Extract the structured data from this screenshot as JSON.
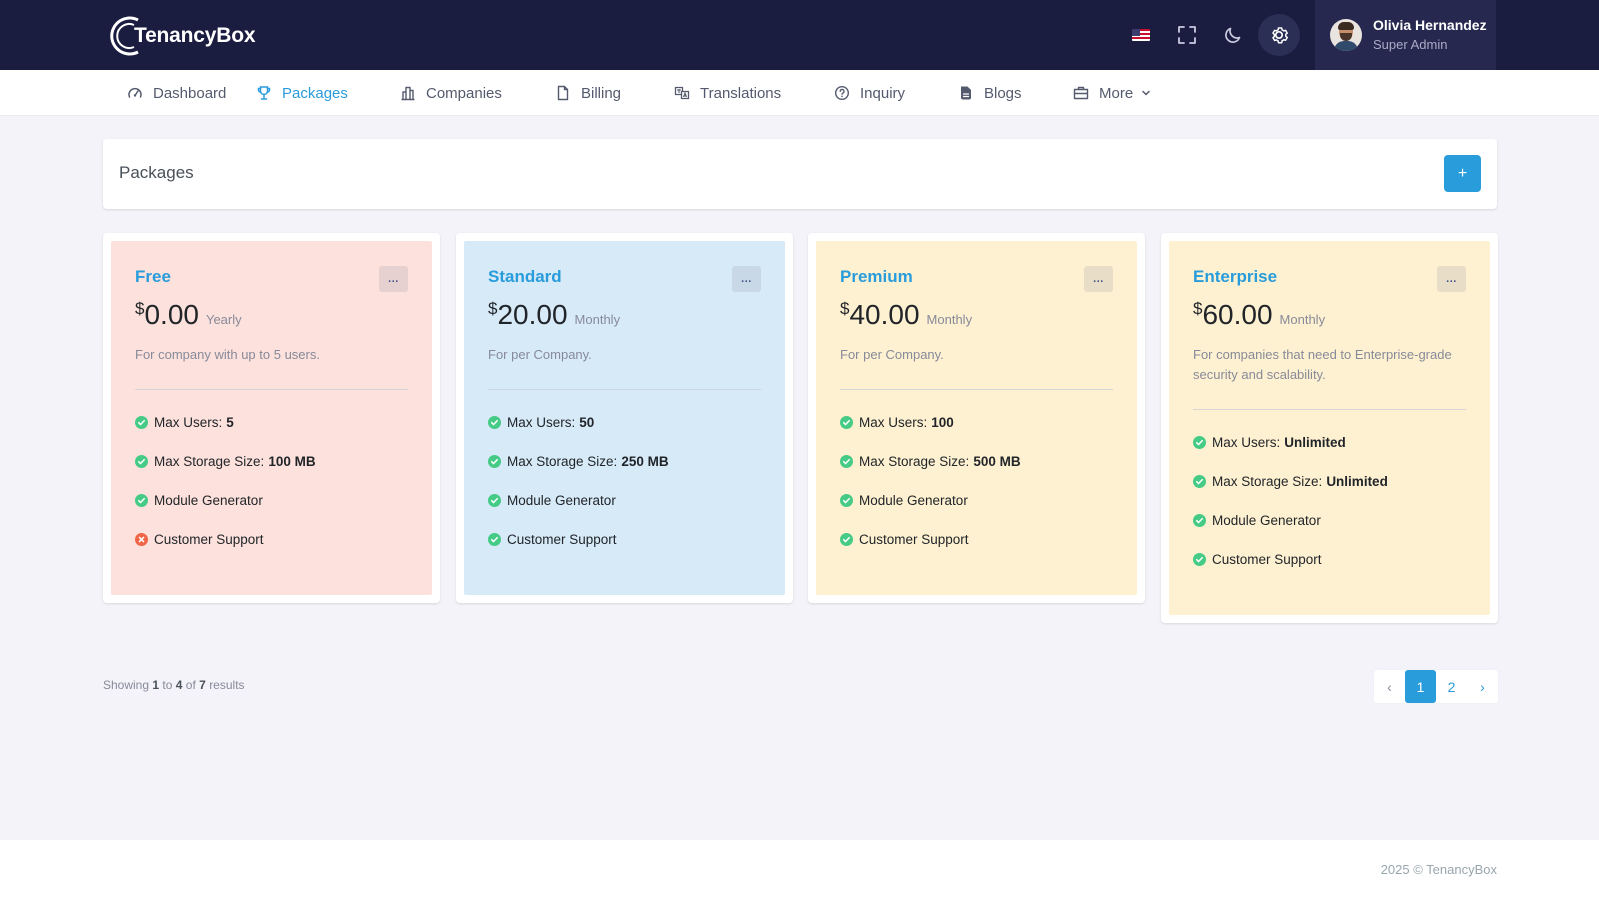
{
  "brand": {
    "name": "TenancyBox"
  },
  "header": {
    "icons": [
      "us-flag-icon",
      "fullscreen-icon",
      "moon-icon",
      "gear-icon"
    ],
    "user": {
      "name": "Olivia Hernandez",
      "role": "Super Admin"
    }
  },
  "nav": {
    "items": [
      {
        "label": "Dashboard",
        "icon": "gauge-icon"
      },
      {
        "label": "Packages",
        "icon": "trophy-icon",
        "active": true
      },
      {
        "label": "Companies",
        "icon": "building-icon"
      },
      {
        "label": "Billing",
        "icon": "file-icon"
      },
      {
        "label": "Translations",
        "icon": "translate-icon"
      },
      {
        "label": "Inquiry",
        "icon": "question-circle-icon"
      },
      {
        "label": "Blogs",
        "icon": "blog-icon"
      },
      {
        "label": "More",
        "icon": "briefcase-icon"
      }
    ]
  },
  "page": {
    "title": "Packages",
    "add_label": "+"
  },
  "plans": [
    {
      "name": "Free",
      "currency": "$",
      "price": "0.00",
      "period": "Yearly",
      "description": "For company with up to 5 users.",
      "bg": "#fde1dc",
      "menu_label": "...",
      "features": [
        {
          "label": "Max Users:",
          "value": "5",
          "ok": true
        },
        {
          "label": "Max Storage Size:",
          "value": "100 MB",
          "ok": true
        },
        {
          "label": "Module Generator",
          "value": "",
          "ok": true
        },
        {
          "label": "Customer Support",
          "value": "",
          "ok": false
        }
      ]
    },
    {
      "name": "Standard",
      "currency": "$",
      "price": "20.00",
      "period": "Monthly",
      "description": "For per Company.",
      "bg": "#d7eaf8",
      "menu_label": "...",
      "features": [
        {
          "label": "Max Users:",
          "value": "50",
          "ok": true
        },
        {
          "label": "Max Storage Size:",
          "value": "250 MB",
          "ok": true
        },
        {
          "label": "Module Generator",
          "value": "",
          "ok": true
        },
        {
          "label": "Customer Support",
          "value": "",
          "ok": true
        }
      ]
    },
    {
      "name": "Premium",
      "currency": "$",
      "price": "40.00",
      "period": "Monthly",
      "description": "For per Company.",
      "bg": "#fef1d1",
      "menu_label": "...",
      "features": [
        {
          "label": "Max Users:",
          "value": "100",
          "ok": true
        },
        {
          "label": "Max Storage Size:",
          "value": "500 MB",
          "ok": true
        },
        {
          "label": "Module Generator",
          "value": "",
          "ok": true
        },
        {
          "label": "Customer Support",
          "value": "",
          "ok": true
        }
      ]
    },
    {
      "name": "Enterprise",
      "currency": "$",
      "price": "60.00",
      "period": "Monthly",
      "description": "For companies that need to Enterprise-grade security and scalability.",
      "bg": "#fef1d1",
      "menu_label": "...",
      "features": [
        {
          "label": "Max Users:",
          "value": "Unlimited",
          "ok": true
        },
        {
          "label": "Max Storage Size:",
          "value": "Unlimited",
          "ok": true
        },
        {
          "label": "Module Generator",
          "value": "",
          "ok": true
        },
        {
          "label": "Customer Support",
          "value": "",
          "ok": true
        }
      ]
    }
  ],
  "results": {
    "prefix": "Showing",
    "from": "1",
    "to_word": "to",
    "to": "4",
    "of_word": "of",
    "total": "7",
    "suffix": "results"
  },
  "pagination": {
    "prev": "‹",
    "pages": [
      "1",
      "2"
    ],
    "current": "1",
    "next": "›"
  },
  "footer": {
    "text": "2025 © TenancyBox"
  },
  "colors": {
    "primary": "#299cdb",
    "topbar": "#1b1d40",
    "success": "#45cb85",
    "danger": "#f06548"
  }
}
